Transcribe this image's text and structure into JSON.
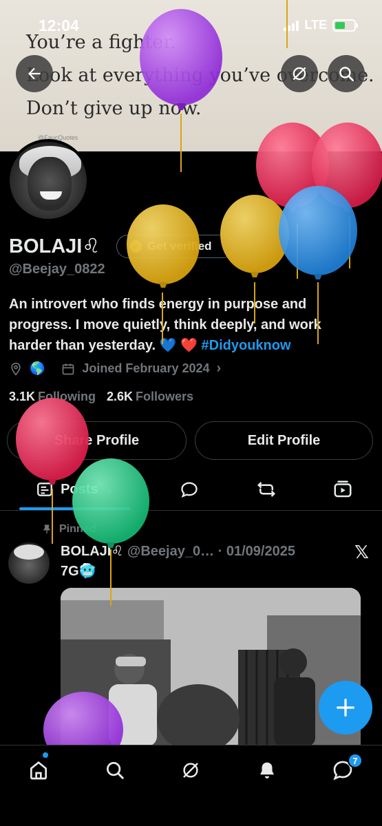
{
  "status_bar": {
    "time": "12:04",
    "network": "LTE"
  },
  "banner": {
    "quote_lines": [
      "You’re a fighter.",
      "Look at everything you’ve overcome.",
      "Don’t give up now."
    ],
    "credit": "@FaucQuotes"
  },
  "profile": {
    "name": "BOLAJI♌",
    "get_verified": "Get verified",
    "handle": "@Beejay_0822",
    "bio": "An introvert who finds energy in purpose and progress. I move quietly, think deeply, and work harder than yesterday. 💙 ❤️ ",
    "bio_hashtag": "#Didyouknow",
    "location": "🌎",
    "joined": "Joined February 2024",
    "following_count": "3.1K",
    "following_label": "Following",
    "followers_count": "2.6K",
    "followers_label": "Followers",
    "share_button": "Share Profile",
    "edit_button": "Edit Profile"
  },
  "tabs": {
    "posts_label": "Posts"
  },
  "post": {
    "pinned_label": "Pinned",
    "author_name": "BOLAJI♌",
    "author_handle": "@Beejay_0…",
    "date": "· 01/09/2025",
    "text": "7G🥶"
  },
  "bottom_nav": {
    "messages_badge": "7"
  },
  "colors": {
    "accent": "#1d9bf0",
    "background": "#000000",
    "muted": "#71767b",
    "balloon_purple": "#a43be8",
    "balloon_pink": "#e8325c",
    "balloon_yellow": "#e6b51e",
    "balloon_blue": "#2d8fe0",
    "balloon_green": "#22cc88"
  },
  "icons": [
    "back-arrow-icon",
    "grok-icon",
    "search-icon",
    "location-icon",
    "calendar-icon",
    "chevron-right-icon",
    "pin-icon",
    "x-logo-icon",
    "home-icon",
    "explore-icon",
    "bell-icon",
    "messages-icon",
    "plus-icon",
    "reply-icon",
    "repost-icon",
    "media-icon"
  ]
}
